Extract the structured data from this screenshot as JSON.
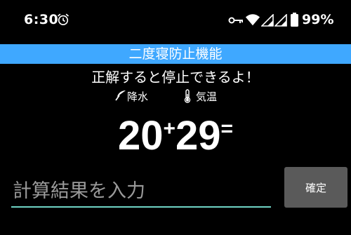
{
  "status_bar": {
    "time": "6:30",
    "battery": "99%",
    "icons": [
      "alarm-icon",
      "key-icon",
      "wifi-icon",
      "cell-signal-icon",
      "cell-signal-icon",
      "battery-icon"
    ]
  },
  "title": "二度寝防止機能",
  "instruction": "正解すると停止できるよ！",
  "weather": {
    "rain_label": "降水",
    "temp_label": "気温"
  },
  "problem": {
    "a": "20",
    "op": "+",
    "b": "29",
    "eq": "="
  },
  "answer": {
    "value": "",
    "placeholder": "計算結果を入力"
  },
  "confirm_label": "確定",
  "colors": {
    "title_bar": "#3fa8ff",
    "field_underline": "#6fd3c4",
    "button": "#5a5a5a"
  }
}
